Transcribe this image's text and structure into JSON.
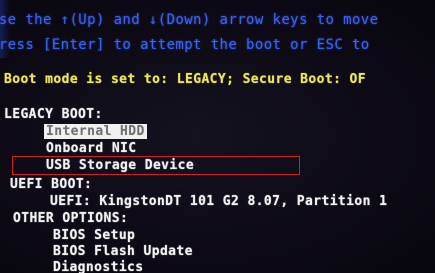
{
  "instructions": {
    "line1": "Use the ↑(Up) and ↓(Down) arrow keys to move",
    "line2": "Press [Enter] to attempt the boot or ESC to"
  },
  "boot_mode": {
    "text": "Boot mode is set to: LEGACY; Secure Boot: OF"
  },
  "legacy_boot": {
    "header": "LEGACY BOOT:",
    "items": [
      {
        "label": "Internal HDD",
        "state": "highlighted"
      },
      {
        "label": "Onboard NIC"
      },
      {
        "label": "USB Storage Device",
        "state": "outlined"
      }
    ]
  },
  "uefi_boot": {
    "header": "UEFI BOOT:",
    "items": [
      {
        "label": "UEFI: KingstonDT 101 G2 8.07, Partition 1"
      }
    ]
  },
  "other_options": {
    "header": "OTHER OPTIONS:",
    "items": [
      {
        "label": "BIOS Setup"
      },
      {
        "label": "BIOS Flash Update"
      },
      {
        "label": "Diagnostics"
      }
    ]
  },
  "colors": {
    "background": "#0b0814",
    "instruction_text": "#3d63e6",
    "boot_mode_text": "#ece85a",
    "menu_text": "#f2f2f2",
    "highlight_bg": "#f1f1f1",
    "annotation_box": "#d02020"
  }
}
